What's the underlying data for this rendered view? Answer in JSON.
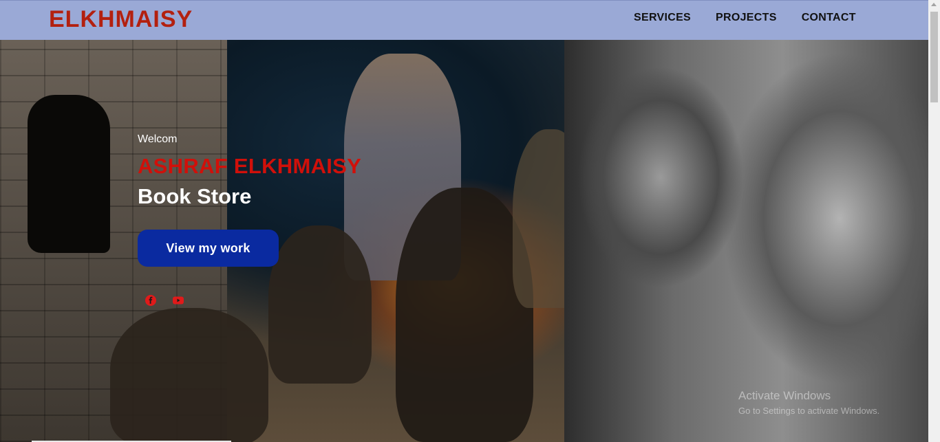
{
  "navbar": {
    "logo": "ELKHMAISY",
    "links": [
      "SERVICES",
      "PROJECTS",
      "CONTACT"
    ]
  },
  "hero": {
    "welcome": "Welcom",
    "author": "ASHRAF ELKHMAISY",
    "subtitle": "Book Store",
    "cta_label": "View my work",
    "socials": [
      "facebook-icon",
      "youtube-icon"
    ]
  },
  "watermark": {
    "line1": "Activate Windows",
    "line2": "Go to Settings to activate Windows."
  },
  "colors": {
    "navbar_bg": "#9aa9d6",
    "logo": "#b3200f",
    "author": "#d0100a",
    "cta_bg": "#0a2aa0"
  }
}
